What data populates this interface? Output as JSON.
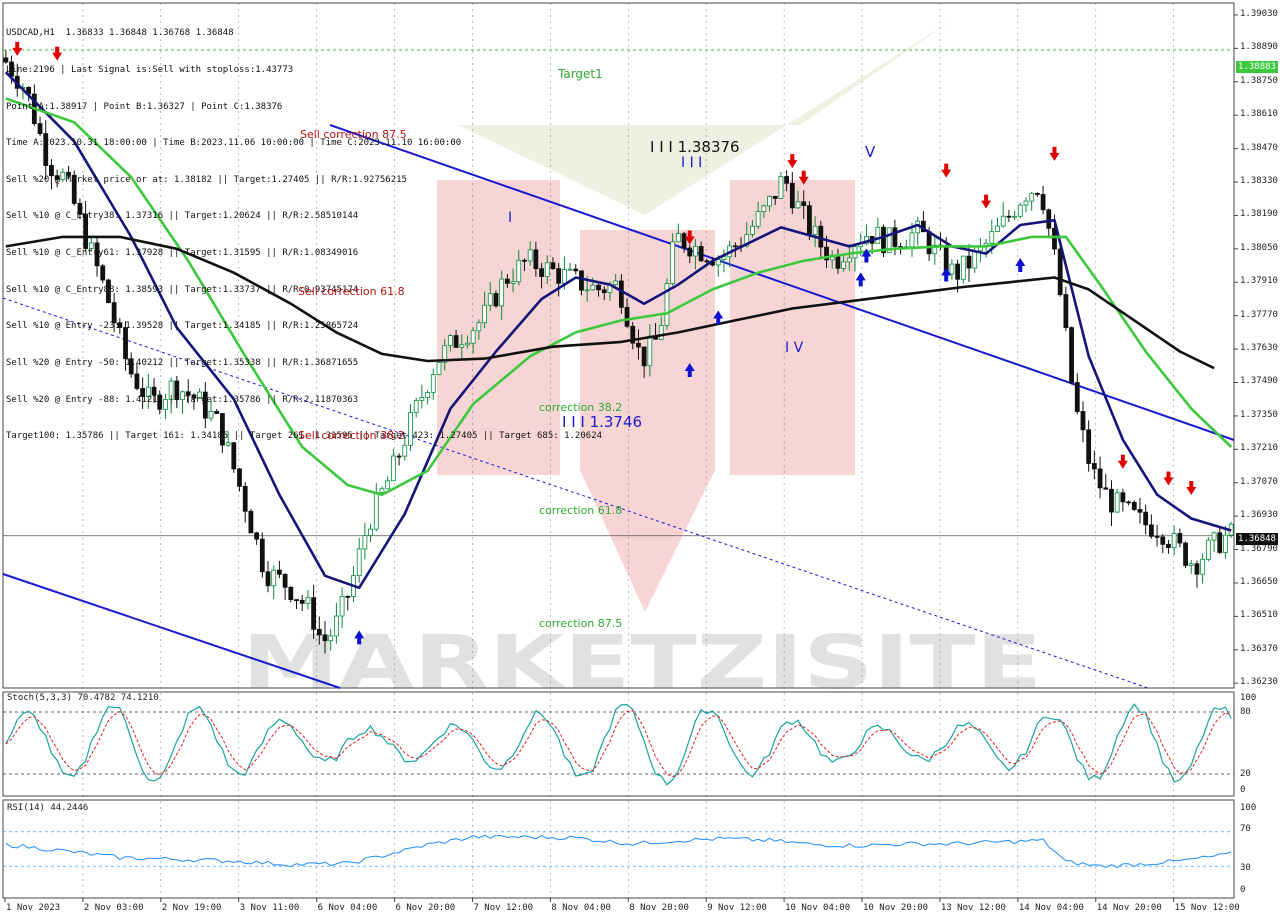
{
  "symbol_header": "USDCAD,H1  1.36833 1.36848 1.36768 1.36848",
  "info_lines": [
    "Line:2196 | Last Signal is:Sell with stoploss:1.43773",
    "Point A:1.38917 | Point B:1.36327 | Point C:1.38376",
    "Time A:2023.10.31 18:00:00 | Time B:2023.11.06 10:00:00 | Time C:2023.11.10 16:00:00",
    "Sell %20 @ Market price or at: 1.38182 || Target:1.27405 || R/R:1.92756215",
    "Sell %10 @ C_Entry38: 1.37316 || Target:1.20624 || R/R:2.58510144",
    "Sell %10 @ C_Entry61: 1.37928 || Target:1.31595 || R/R:1.08349016",
    "Sell %10 @ C_Entry88: 1.38593 || Target:1.33737 || R/R:0.93745174",
    "Sell %10 @ Entry -23: 1.39528 || Target:1.34185 || R/R:1.25865724",
    "Sell %20 @ Entry -50: 1.40212 || Target:1.35338 || R/R:1.36871655",
    "Sell %20 @ Entry -88: 1.41212 || Target:1.35786 || R/R:2.11870363",
    "Target100: 1.35786 || Target 161: 1.34185 || Target 261: 1.31595 || Target 423: 1.27405 || Target 685: 1.20624"
  ],
  "annotations": {
    "target1": "Target1",
    "sell_corr_875": "Sell correction 87.5",
    "sell_corr_618": "Sell correction 61.8",
    "sell_corr_382": "Sell correction 38.2",
    "corr_382": "correction 38.2",
    "corr_618": "correction 61.8",
    "corr_875": "correction 87.5",
    "wave_i": "I",
    "wave_iii_label": "I I I 1.38376",
    "wave_iii": "I I I",
    "wave_iii_b": "I I I 1.3746",
    "wave_iv": "I V",
    "wave_v": "V"
  },
  "watermark": "MARKETZISITE",
  "price_current": "1.36848",
  "price_target": "1.38883",
  "stoch_label": "Stoch(5,3,3) 70.4782 74.1210",
  "rsi_label": "RSI(14) 44.2446",
  "stoch_levels": [
    "100",
    "80",
    "20",
    "0"
  ],
  "rsi_levels": [
    "100",
    "70",
    "30",
    "0"
  ],
  "colors": {
    "bull": "#0a8a3a",
    "bear": "#111111",
    "ma_fast": "#14147a",
    "ma_mid": "#3cc83c",
    "ma_slow": "#111111",
    "channel": "#1a1ad2",
    "arrow_sell": "#e00000",
    "arrow_buy": "#1010d0",
    "stoch_main": "#18a3a3",
    "stoch_signal": "#e02020",
    "rsi": "#1e8cff",
    "target_line": "#3cb83c"
  },
  "chart_data": {
    "type": "candlestick",
    "title": "USDCAD,H1",
    "ohlc_header": [
      1.36833,
      1.36848,
      1.36768,
      1.36848
    ],
    "y_ticks": [
      "1.39030",
      "1.38890",
      "1.38750",
      "1.38610",
      "1.38470",
      "1.38330",
      "1.38190",
      "1.38050",
      "1.37910",
      "1.37770",
      "1.37630",
      "1.37490",
      "1.37350",
      "1.37210",
      "1.37070",
      "1.36930",
      "1.36790",
      "1.36650",
      "1.36510",
      "1.36370",
      "1.36230"
    ],
    "ylim": [
      1.3621,
      1.3908
    ],
    "x_ticks": [
      "1 Nov 2023",
      "2 Nov 03:00",
      "2 Nov 19:00",
      "3 Nov 11:00",
      "6 Nov 04:00",
      "6 Nov 20:00",
      "7 Nov 12:00",
      "8 Nov 04:00",
      "8 Nov 20:00",
      "9 Nov 12:00",
      "10 Nov 04:00",
      "10 Nov 20:00",
      "13 Nov 12:00",
      "14 Nov 04:00",
      "14 Nov 20:00",
      "15 Nov 12:00"
    ],
    "path_points": [
      [
        0,
        1.3885
      ],
      [
        4,
        1.3872
      ],
      [
        8,
        1.3841
      ],
      [
        11,
        1.3834
      ],
      [
        14,
        1.3813
      ],
      [
        18,
        1.3787
      ],
      [
        22,
        1.3755
      ],
      [
        26,
        1.374
      ],
      [
        30,
        1.3748
      ],
      [
        34,
        1.3742
      ],
      [
        38,
        1.3731
      ],
      [
        42,
        1.3702
      ],
      [
        46,
        1.367
      ],
      [
        50,
        1.3664
      ],
      [
        54,
        1.3653
      ],
      [
        56,
        1.364
      ],
      [
        58,
        1.3645
      ],
      [
        61,
        1.3663
      ],
      [
        64,
        1.369
      ],
      [
        68,
        1.371
      ],
      [
        72,
        1.3735
      ],
      [
        76,
        1.3758
      ],
      [
        80,
        1.3768
      ],
      [
        84,
        1.3775
      ],
      [
        88,
        1.3792
      ],
      [
        92,
        1.38
      ],
      [
        96,
        1.3796
      ],
      [
        100,
        1.3792
      ],
      [
        104,
        1.3788
      ],
      [
        108,
        1.379
      ],
      [
        112,
        1.3758
      ],
      [
        115,
        1.3768
      ],
      [
        118,
        1.381
      ],
      [
        122,
        1.3805
      ],
      [
        126,
        1.3801
      ],
      [
        130,
        1.381
      ],
      [
        134,
        1.3822
      ],
      [
        137,
        1.3835
      ],
      [
        140,
        1.382
      ],
      [
        143,
        1.3808
      ],
      [
        146,
        1.38
      ],
      [
        149,
        1.3808
      ],
      [
        152,
        1.3812
      ],
      [
        155,
        1.3808
      ],
      [
        158,
        1.381
      ],
      [
        161,
        1.3812
      ],
      [
        164,
        1.3802
      ],
      [
        167,
        1.3794
      ],
      [
        170,
        1.38
      ],
      [
        173,
        1.3808
      ],
      [
        176,
        1.3817
      ],
      [
        179,
        1.3828
      ],
      [
        182,
        1.3832
      ],
      [
        185,
        1.3795
      ],
      [
        188,
        1.374
      ],
      [
        191,
        1.3712
      ],
      [
        194,
        1.37
      ],
      [
        197,
        1.3695
      ],
      [
        200,
        1.369
      ],
      [
        203,
        1.3688
      ],
      [
        206,
        1.368
      ],
      [
        209,
        1.3673
      ],
      [
        212,
        1.368
      ],
      [
        215,
        1.3685
      ]
    ],
    "n_bars": 216,
    "moving_averages": [
      {
        "name": "MA fast",
        "values": [
          [
            0,
            1.3879
          ],
          [
            12,
            1.385
          ],
          [
            22,
            1.381
          ],
          [
            30,
            1.3772
          ],
          [
            40,
            1.3742
          ],
          [
            48,
            1.3702
          ],
          [
            56,
            1.3668
          ],
          [
            62,
            1.3663
          ],
          [
            70,
            1.3694
          ],
          [
            78,
            1.3738
          ],
          [
            86,
            1.3762
          ],
          [
            94,
            1.3784
          ],
          [
            100,
            1.3793
          ],
          [
            106,
            1.379
          ],
          [
            112,
            1.3782
          ],
          [
            118,
            1.379
          ],
          [
            124,
            1.38
          ],
          [
            130,
            1.3807
          ],
          [
            136,
            1.3814
          ],
          [
            142,
            1.381
          ],
          [
            148,
            1.3806
          ],
          [
            154,
            1.381
          ],
          [
            160,
            1.3815
          ],
          [
            166,
            1.3806
          ],
          [
            172,
            1.3803
          ],
          [
            178,
            1.3815
          ],
          [
            184,
            1.3817
          ],
          [
            190,
            1.376
          ],
          [
            196,
            1.3725
          ],
          [
            202,
            1.3702
          ],
          [
            208,
            1.3692
          ],
          [
            215,
            1.3687
          ]
        ]
      },
      {
        "name": "MA mid",
        "values": [
          [
            0,
            1.3868
          ],
          [
            12,
            1.3858
          ],
          [
            22,
            1.3835
          ],
          [
            32,
            1.38
          ],
          [
            42,
            1.376
          ],
          [
            52,
            1.3722
          ],
          [
            60,
            1.3706
          ],
          [
            66,
            1.3702
          ],
          [
            74,
            1.3712
          ],
          [
            82,
            1.374
          ],
          [
            92,
            1.376
          ],
          [
            100,
            1.377
          ],
          [
            108,
            1.3775
          ],
          [
            116,
            1.3778
          ],
          [
            124,
            1.3788
          ],
          [
            132,
            1.3795
          ],
          [
            140,
            1.38
          ],
          [
            148,
            1.3803
          ],
          [
            156,
            1.3805
          ],
          [
            164,
            1.3806
          ],
          [
            172,
            1.3806
          ],
          [
            180,
            1.381
          ],
          [
            186,
            1.381
          ],
          [
            192,
            1.379
          ],
          [
            200,
            1.3762
          ],
          [
            208,
            1.3738
          ],
          [
            215,
            1.3722
          ]
        ]
      },
      {
        "name": "MA slow",
        "values": [
          [
            0,
            1.3806
          ],
          [
            10,
            1.381
          ],
          [
            20,
            1.381
          ],
          [
            30,
            1.3805
          ],
          [
            40,
            1.3795
          ],
          [
            50,
            1.3782
          ],
          [
            58,
            1.377
          ],
          [
            66,
            1.3761
          ],
          [
            74,
            1.3758
          ],
          [
            84,
            1.3759
          ],
          [
            96,
            1.3764
          ],
          [
            108,
            1.3766
          ],
          [
            118,
            1.377
          ],
          [
            128,
            1.3775
          ],
          [
            138,
            1.378
          ],
          [
            148,
            1.3783
          ],
          [
            158,
            1.3786
          ],
          [
            168,
            1.3789
          ],
          [
            176,
            1.3791
          ],
          [
            184,
            1.3793
          ],
          [
            190,
            1.3788
          ],
          [
            198,
            1.3775
          ],
          [
            206,
            1.3762
          ],
          [
            212,
            1.3755
          ]
        ]
      }
    ],
    "stoch_ylim": [
      0,
      100
    ],
    "rsi_ylim": [
      0,
      100
    ],
    "rsi_values": [
      [
        0,
        55
      ],
      [
        10,
        48
      ],
      [
        20,
        40
      ],
      [
        30,
        38
      ],
      [
        40,
        36
      ],
      [
        50,
        32
      ],
      [
        60,
        33
      ],
      [
        66,
        42
      ],
      [
        74,
        55
      ],
      [
        82,
        64
      ],
      [
        90,
        64
      ],
      [
        100,
        63
      ],
      [
        110,
        56
      ],
      [
        118,
        60
      ],
      [
        126,
        62
      ],
      [
        134,
        60
      ],
      [
        142,
        55
      ],
      [
        150,
        54
      ],
      [
        158,
        56
      ],
      [
        166,
        56
      ],
      [
        174,
        58
      ],
      [
        182,
        60
      ],
      [
        186,
        35
      ],
      [
        192,
        30
      ],
      [
        198,
        32
      ],
      [
        206,
        36
      ],
      [
        215,
        44.2446
      ]
    ]
  }
}
